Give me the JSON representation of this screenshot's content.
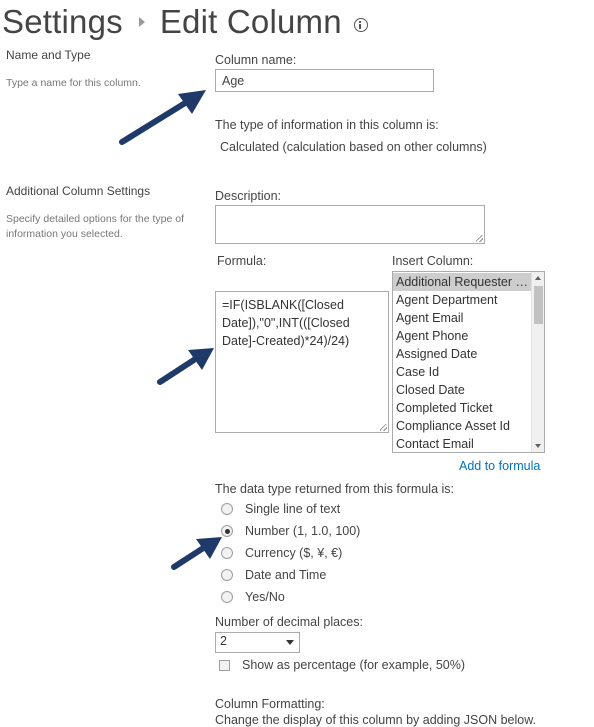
{
  "header": {
    "breadcrumb_parent": "Settings",
    "page_title": "Edit Column"
  },
  "name_type_section": {
    "heading": "Name and Type",
    "description": "Type a name for this column.",
    "column_name_label": "Column name:",
    "column_name_value": "Age",
    "type_info_label": "The type of information in this column is:",
    "type_value": "Calculated (calculation based on other columns)"
  },
  "additional_section": {
    "heading": "Additional Column Settings",
    "description_line1": "Specify detailed options for the type of",
    "description_line2": "information you selected.",
    "description_label": "Description:",
    "description_value": "",
    "formula_label": "Formula:",
    "formula_lines": [
      "=IF(ISBLANK([Closed",
      "Date]),\"0\",INT(([Closed",
      "Date]-Created)*24)/24)"
    ],
    "insert_column_label": "Insert Column:",
    "insert_columns": [
      "Additional Requester Email",
      "Agent Department",
      "Agent Email",
      "Agent Phone",
      "Assigned Date",
      "Case Id",
      "Closed Date",
      "Completed Ticket",
      "Compliance Asset Id",
      "Contact Email"
    ],
    "selected_column_index": 0,
    "add_to_formula_label": "Add to formula",
    "return_type_label": "The data type returned from this formula is:",
    "return_types": [
      {
        "label": "Single line of text",
        "selected": false
      },
      {
        "label": "Number (1, 1.0, 100)",
        "selected": true
      },
      {
        "label": "Currency ($, ¥, €)",
        "selected": false
      },
      {
        "label": "Date and Time",
        "selected": false
      },
      {
        "label": "Yes/No",
        "selected": false
      }
    ],
    "decimal_places_label": "Number of decimal places:",
    "decimal_places_value": "2",
    "show_percentage_label": "Show as percentage (for example, 50%)",
    "show_percentage_checked": false,
    "column_formatting_label": "Column Formatting:",
    "column_formatting_desc": "Change the display of this column by adding JSON below."
  },
  "colors": {
    "link": "#0072c6",
    "annotation_arrow": "#1f3a68",
    "selected_item_bg": "#cdcdcd"
  }
}
